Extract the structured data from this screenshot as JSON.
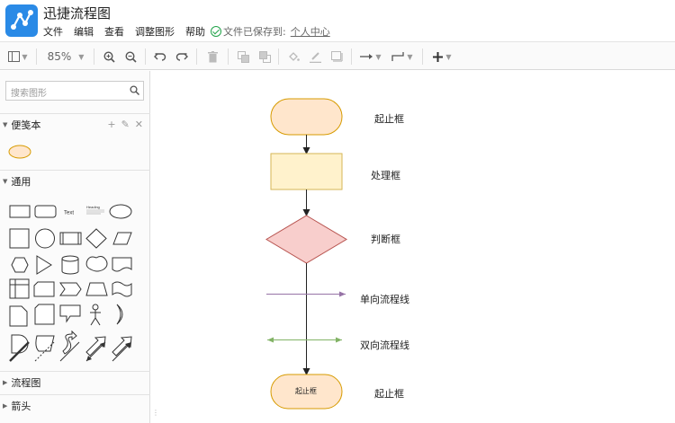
{
  "app": {
    "title": "迅捷流程图"
  },
  "menu": {
    "items": [
      "文件",
      "编辑",
      "查看",
      "调整图形",
      "帮助"
    ],
    "saved_text": "文件已保存到:",
    "saved_location": "个人中心"
  },
  "toolbar": {
    "zoom": "85%"
  },
  "sidebar": {
    "search_placeholder": "搜索图形",
    "sections": {
      "notes": "便笺本",
      "general": "通用",
      "flowchart": "流程图",
      "arrows": "箭头"
    },
    "shape_text_label": "Text",
    "shape_heading_label": "Heading"
  },
  "canvas": {
    "labels": {
      "start": "起止框",
      "process": "处理框",
      "decision": "判断框",
      "one_way": "单向流程线",
      "two_way": "双向流程线",
      "end": "起止框"
    },
    "end_shape_text": "起止框"
  },
  "colors": {
    "terminator_fill": "#ffe6cc",
    "terminator_stroke": "#d79b00",
    "process_fill": "#fff2cc",
    "process_stroke": "#d6b656",
    "decision_fill": "#f8cecc",
    "decision_stroke": "#b85450",
    "purple_line": "#9673a6",
    "green_line": "#82b366",
    "brand_blue": "#2a8ae6"
  }
}
